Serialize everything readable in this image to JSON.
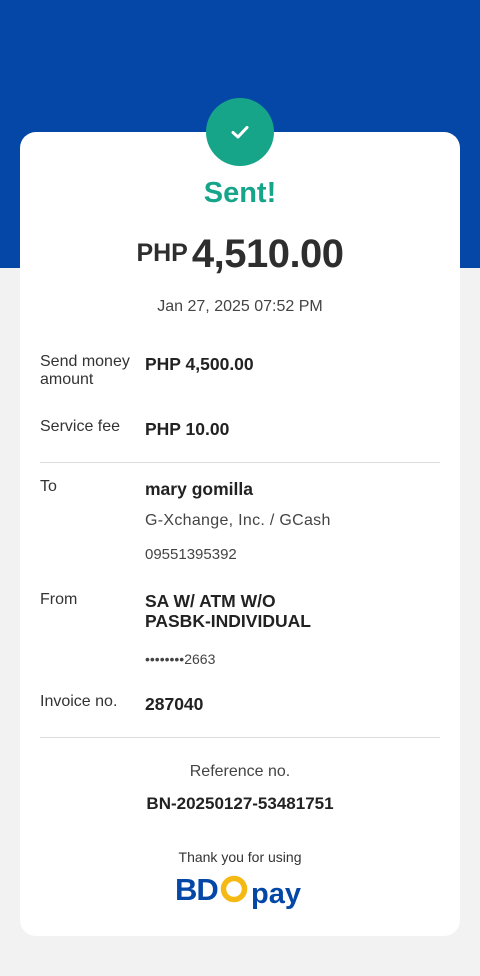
{
  "status": {
    "title": "Sent!",
    "icon": "checkmark-icon",
    "accent_color": "#17a589"
  },
  "brand_color": "#0447a6",
  "amount": {
    "currency": "PHP",
    "value": "4,510.00"
  },
  "date": "Jan 27, 2025 07:52 PM",
  "send_money": {
    "label": "Send money amount",
    "value": "PHP 4,500.00"
  },
  "service_fee": {
    "label": "Service fee",
    "value": "PHP 10.00"
  },
  "to": {
    "label": "To",
    "name": "mary gomilla",
    "provider": "G-Xchange, Inc. / GCash",
    "number": "09551395392"
  },
  "from": {
    "label": "From",
    "account": "SA W/ ATM W/O PASBK-INDIVIDUAL",
    "masked_number": "••••••••2663"
  },
  "invoice": {
    "label": "Invoice no.",
    "value": "287040"
  },
  "reference": {
    "label": "Reference no.",
    "value": "BN-20250127-53481751"
  },
  "footer": {
    "thanks": "Thank you for using",
    "logo_text": "BDO pay"
  }
}
